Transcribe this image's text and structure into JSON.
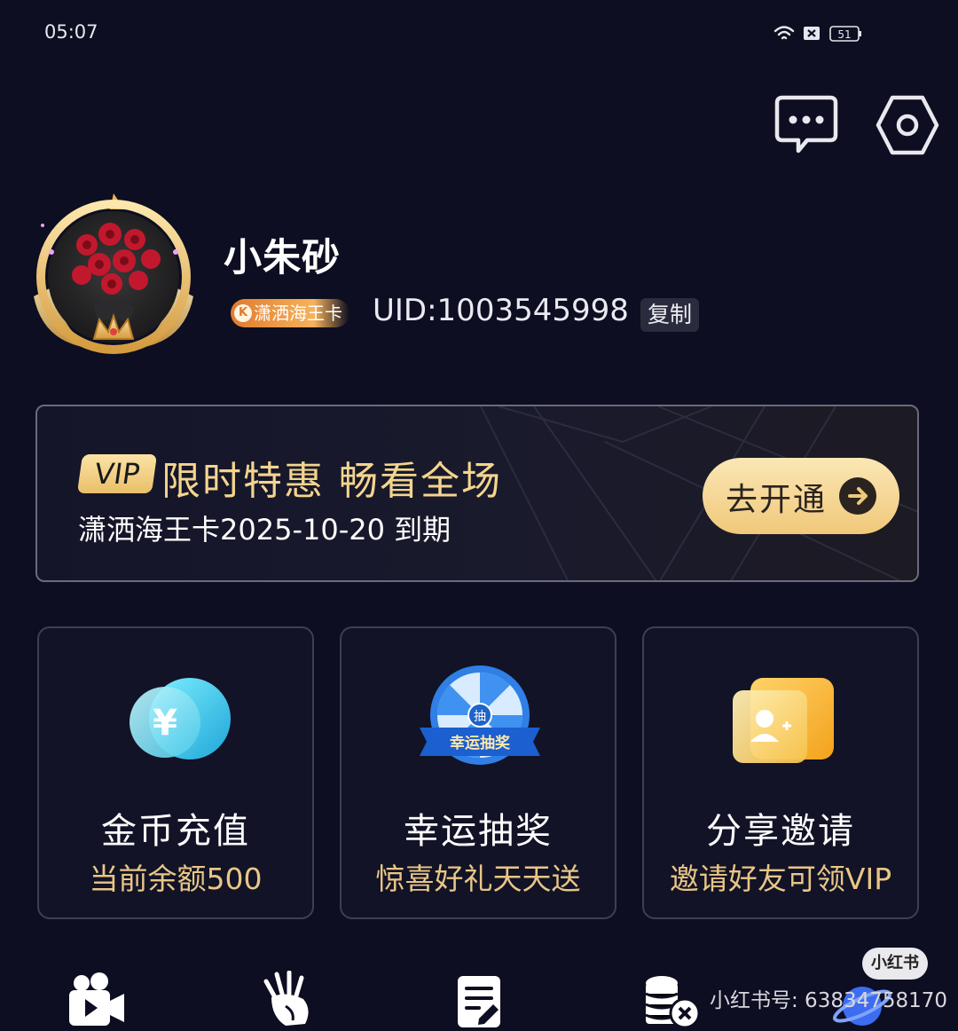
{
  "status_bar": {
    "time": "05:07",
    "battery": "51",
    "icons": [
      "wifi-icon",
      "sim-off-icon",
      "battery-icon"
    ]
  },
  "header": {
    "actions": [
      "message-icon",
      "settings-icon"
    ]
  },
  "profile": {
    "username": "小朱砂",
    "badge": "潇洒海王卡",
    "uid": "UID:1003545998",
    "copy_label": "复制"
  },
  "vip_banner": {
    "tag": "VIP",
    "title": "限时特惠 畅看全场",
    "expire_text": "潇洒海王卡2025-10-20 到期",
    "button_label": "去开通"
  },
  "features": [
    {
      "title": "金币充值",
      "subtitle": "当前余额500",
      "icon": "coin-icon"
    },
    {
      "title": "幸运抽奖",
      "subtitle": "惊喜好礼天天送",
      "icon": "lucky-wheel-icon",
      "icon_text": "抽",
      "ribbon_text": "幸运抽奖"
    },
    {
      "title": "分享邀请",
      "subtitle": "邀请好友可领VIP",
      "icon": "invite-icon"
    }
  ],
  "bottom_nav": [
    "video-icon",
    "hand-icon",
    "notes-icon",
    "coins-icon",
    "planet-icon"
  ],
  "watermark": {
    "logo": "小红书",
    "text": "小红书号: 63834758170"
  },
  "colors": {
    "background": "#0d0e21",
    "gold": "#f3d58d",
    "card_border": "#3e3f55"
  }
}
